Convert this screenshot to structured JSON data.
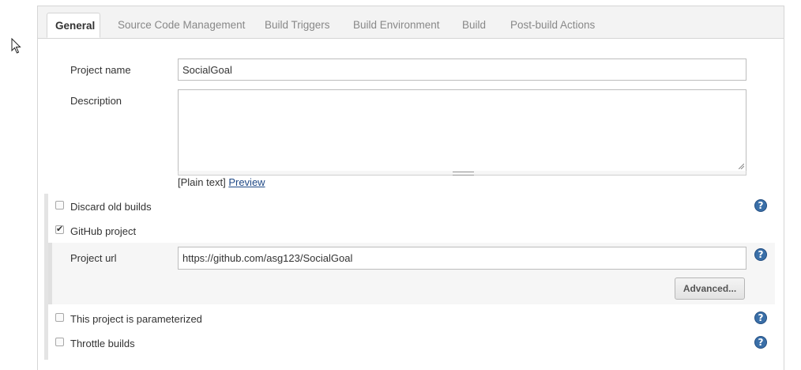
{
  "tabs": [
    {
      "label": "General",
      "active": true
    },
    {
      "label": "Source Code Management"
    },
    {
      "label": "Build Triggers"
    },
    {
      "label": "Build Environment"
    },
    {
      "label": "Build"
    },
    {
      "label": "Post-build Actions"
    }
  ],
  "general": {
    "project_name_label": "Project name",
    "project_name_value": "SocialGoal",
    "description_label": "Description",
    "description_value": "",
    "format_text": "[Plain text]",
    "preview_link": "Preview"
  },
  "options": {
    "discard_old_builds": {
      "label": "Discard old builds",
      "checked": false
    },
    "github_project": {
      "label": "GitHub project",
      "checked": true,
      "check_glyph": "✔"
    },
    "project_url_label": "Project url",
    "project_url_value": "https://github.com/asg123/SocialGoal",
    "advanced_button": "Advanced...",
    "parameterized": {
      "label": "This project is parameterized",
      "checked": false
    },
    "throttle_builds": {
      "label": "Throttle builds",
      "checked": false
    }
  },
  "help_glyph": "?",
  "colors": {
    "help_icon": "#3a6fa8",
    "link": "#204a87"
  }
}
